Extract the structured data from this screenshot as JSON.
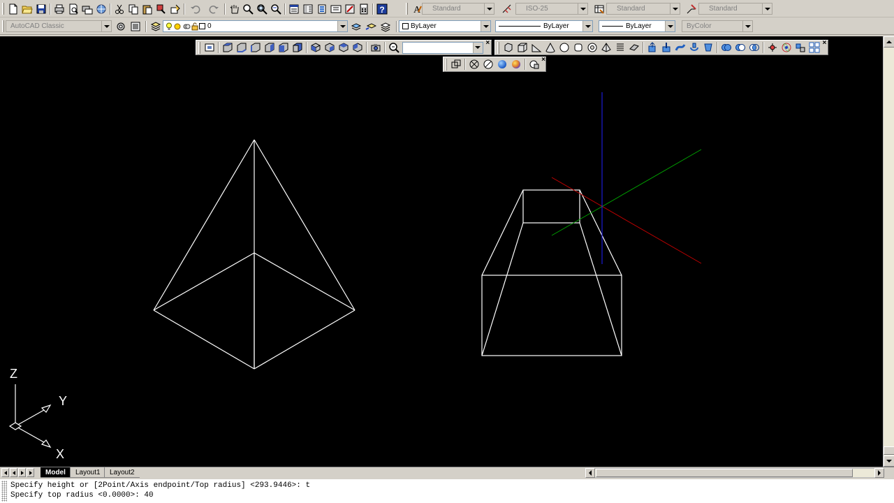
{
  "toolbar_top": {
    "text_style": "Standard",
    "dim_style": "ISO-25",
    "table_style": "Standard",
    "multileader_style": "Standard"
  },
  "toolbar_props": {
    "workspace": "AutoCAD Classic",
    "layer": "0",
    "color": "ByLayer",
    "linetype": "ByLayer",
    "lineweight": "ByLayer",
    "plotstyle": "ByColor"
  },
  "view_toolbar": {
    "named_view": ""
  },
  "ucs_icon": {
    "z": "Z",
    "y": "Y",
    "x": "X"
  },
  "tabs": [
    {
      "label": "Model"
    },
    {
      "label": "Layout1"
    },
    {
      "label": "Layout2"
    }
  ],
  "command": {
    "line1": "Specify height or [2Point/Axis endpoint/Top radius] <293.9446>: t",
    "line2": "Specify top radius <0.0000>: 40"
  },
  "colors": {
    "canvas": "#000000",
    "geometry": "#ffffff",
    "grip_x_axis": "#c00000",
    "grip_y_axis": "#00a000",
    "grip_z_axis": "#2020ff"
  }
}
